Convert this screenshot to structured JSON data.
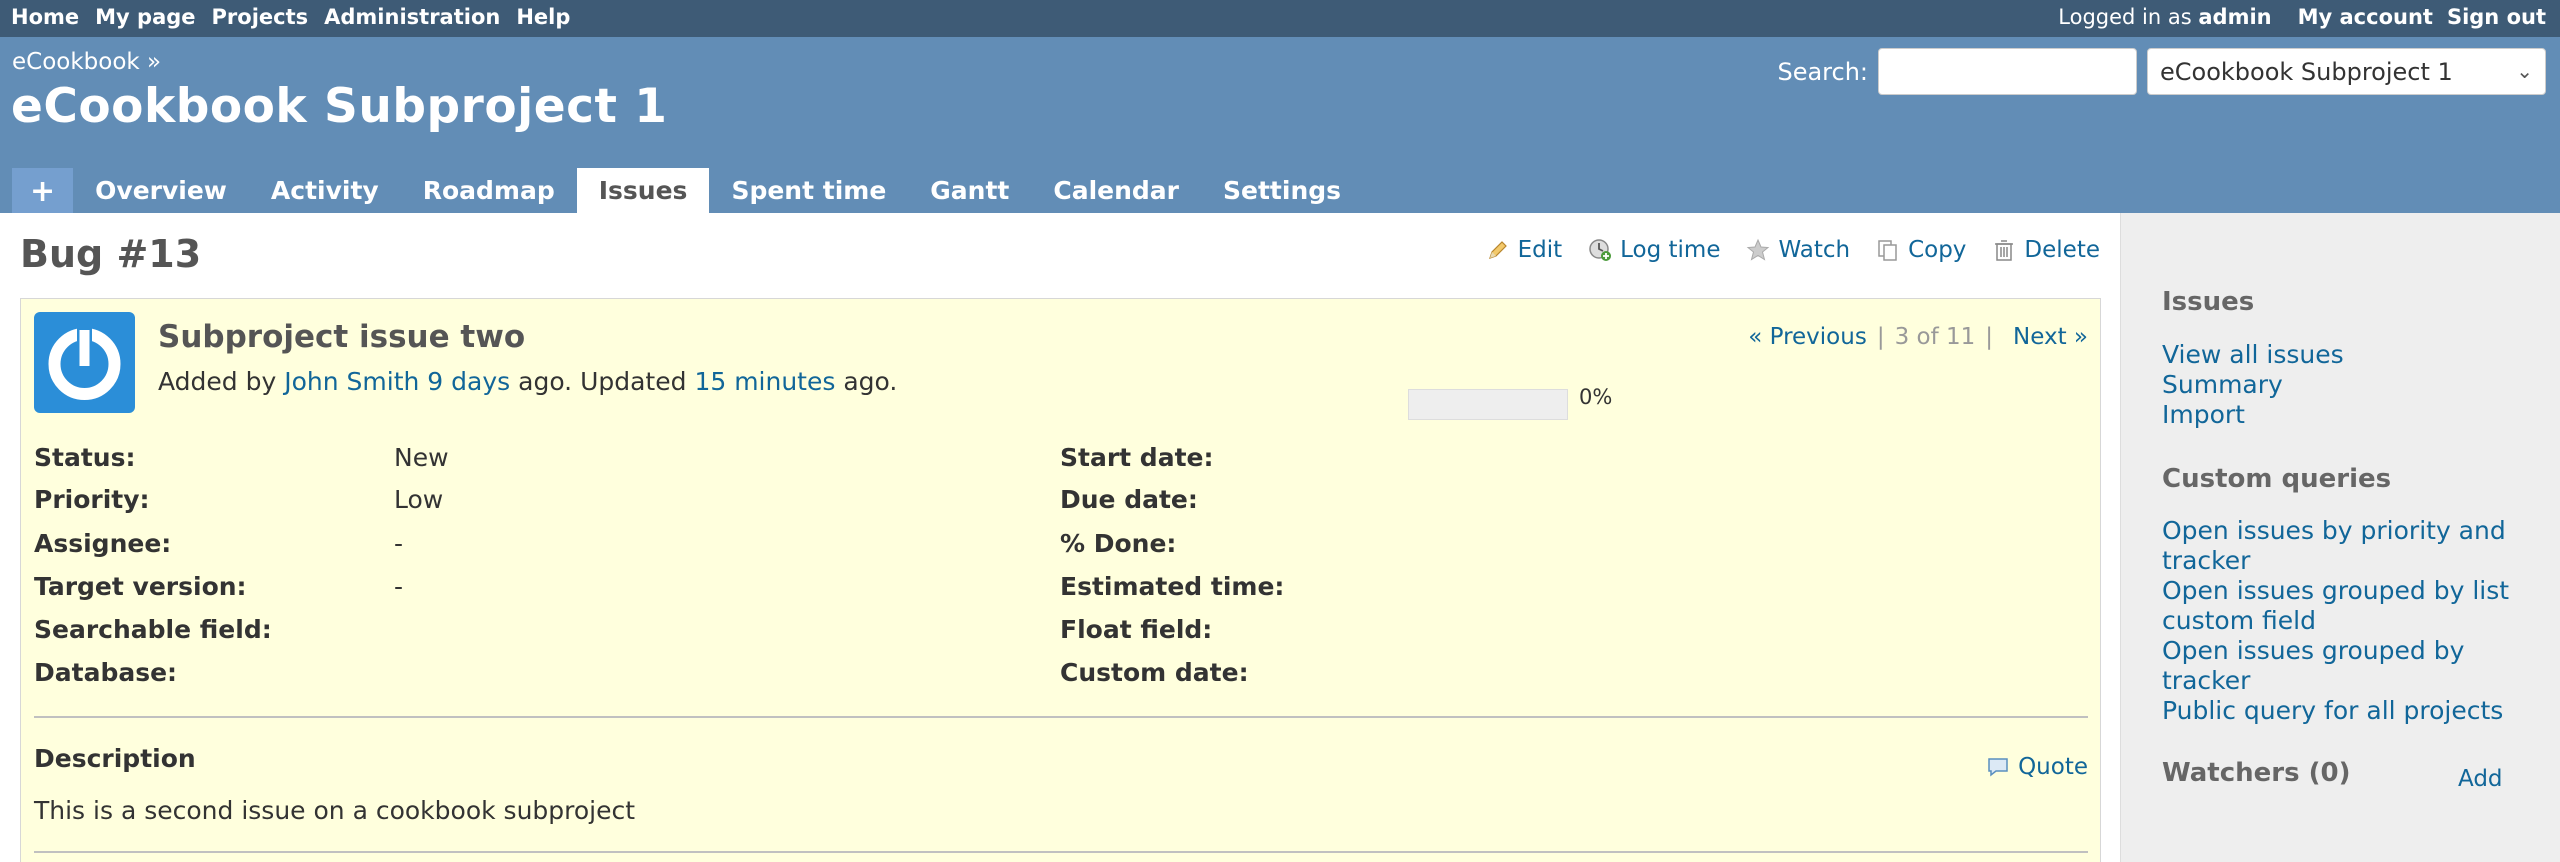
{
  "top_menu": {
    "left": [
      "Home",
      "My page",
      "Projects",
      "Administration",
      "Help"
    ],
    "logged_in_prefix": "Logged in as",
    "logged_in_user": "admin",
    "right": [
      "My account",
      "Sign out"
    ]
  },
  "header": {
    "breadcrumb": "eCookbook »",
    "title": "eCookbook Subproject 1",
    "search_label": "Search:",
    "search_value": "",
    "project_select": "eCookbook Subproject 1"
  },
  "tabs": [
    {
      "label": "+",
      "selected": false
    },
    {
      "label": "Overview",
      "selected": false
    },
    {
      "label": "Activity",
      "selected": false
    },
    {
      "label": "Roadmap",
      "selected": false
    },
    {
      "label": "Issues",
      "selected": true
    },
    {
      "label": "Spent time",
      "selected": false
    },
    {
      "label": "Gantt",
      "selected": false
    },
    {
      "label": "Calendar",
      "selected": false
    },
    {
      "label": "Settings",
      "selected": false
    }
  ],
  "issue": {
    "heading": "Bug #13",
    "actions": {
      "edit": "Edit",
      "log_time": "Log time",
      "watch": "Watch",
      "copy": "Copy",
      "delete": "Delete"
    },
    "subject": "Subproject issue two",
    "author_prefix": "Added by",
    "author": "John Smith",
    "added_ago": "9 days",
    "updated_text": "ago. Updated",
    "updated_ago": "15 minutes",
    "suffix": "ago.",
    "nav": {
      "previous": "« Previous",
      "sep": "|",
      "position": "3 of 11",
      "next": "Next »"
    },
    "attributes_left": [
      {
        "label": "Status:",
        "value": "New"
      },
      {
        "label": "Priority:",
        "value": "Low"
      },
      {
        "label": "Assignee:",
        "value": "-"
      },
      {
        "label": "Target version:",
        "value": "-"
      },
      {
        "label": "Searchable field:",
        "value": ""
      },
      {
        "label": "Database:",
        "value": ""
      }
    ],
    "attributes_right": [
      {
        "label": "Start date:",
        "value": ""
      },
      {
        "label": "Due date:",
        "value": ""
      },
      {
        "label": "% Done:",
        "value": "0%"
      },
      {
        "label": "Estimated time:",
        "value": ""
      },
      {
        "label": "Float field:",
        "value": ""
      },
      {
        "label": "Custom date:",
        "value": ""
      }
    ],
    "done_ratio": 0,
    "description_title": "Description",
    "quote": "Quote",
    "description": "This is a second issue on a cookbook subproject"
  },
  "sidebar": {
    "issues_title": "Issues",
    "issues_links": [
      "View all issues",
      "Summary",
      "Import"
    ],
    "custom_queries_title": "Custom queries",
    "custom_queries": [
      "Open issues by priority and tracker",
      "Open issues grouped by list custom field",
      "Open issues grouped by tracker",
      "Public query for all projects"
    ],
    "watchers_title": "Watchers (0)",
    "watchers_add": "Add"
  },
  "colors": {
    "top_menu_bg": "#3e5b76",
    "header_bg": "#628db6",
    "issue_bg": "#ffffdd",
    "link": "#169"
  }
}
